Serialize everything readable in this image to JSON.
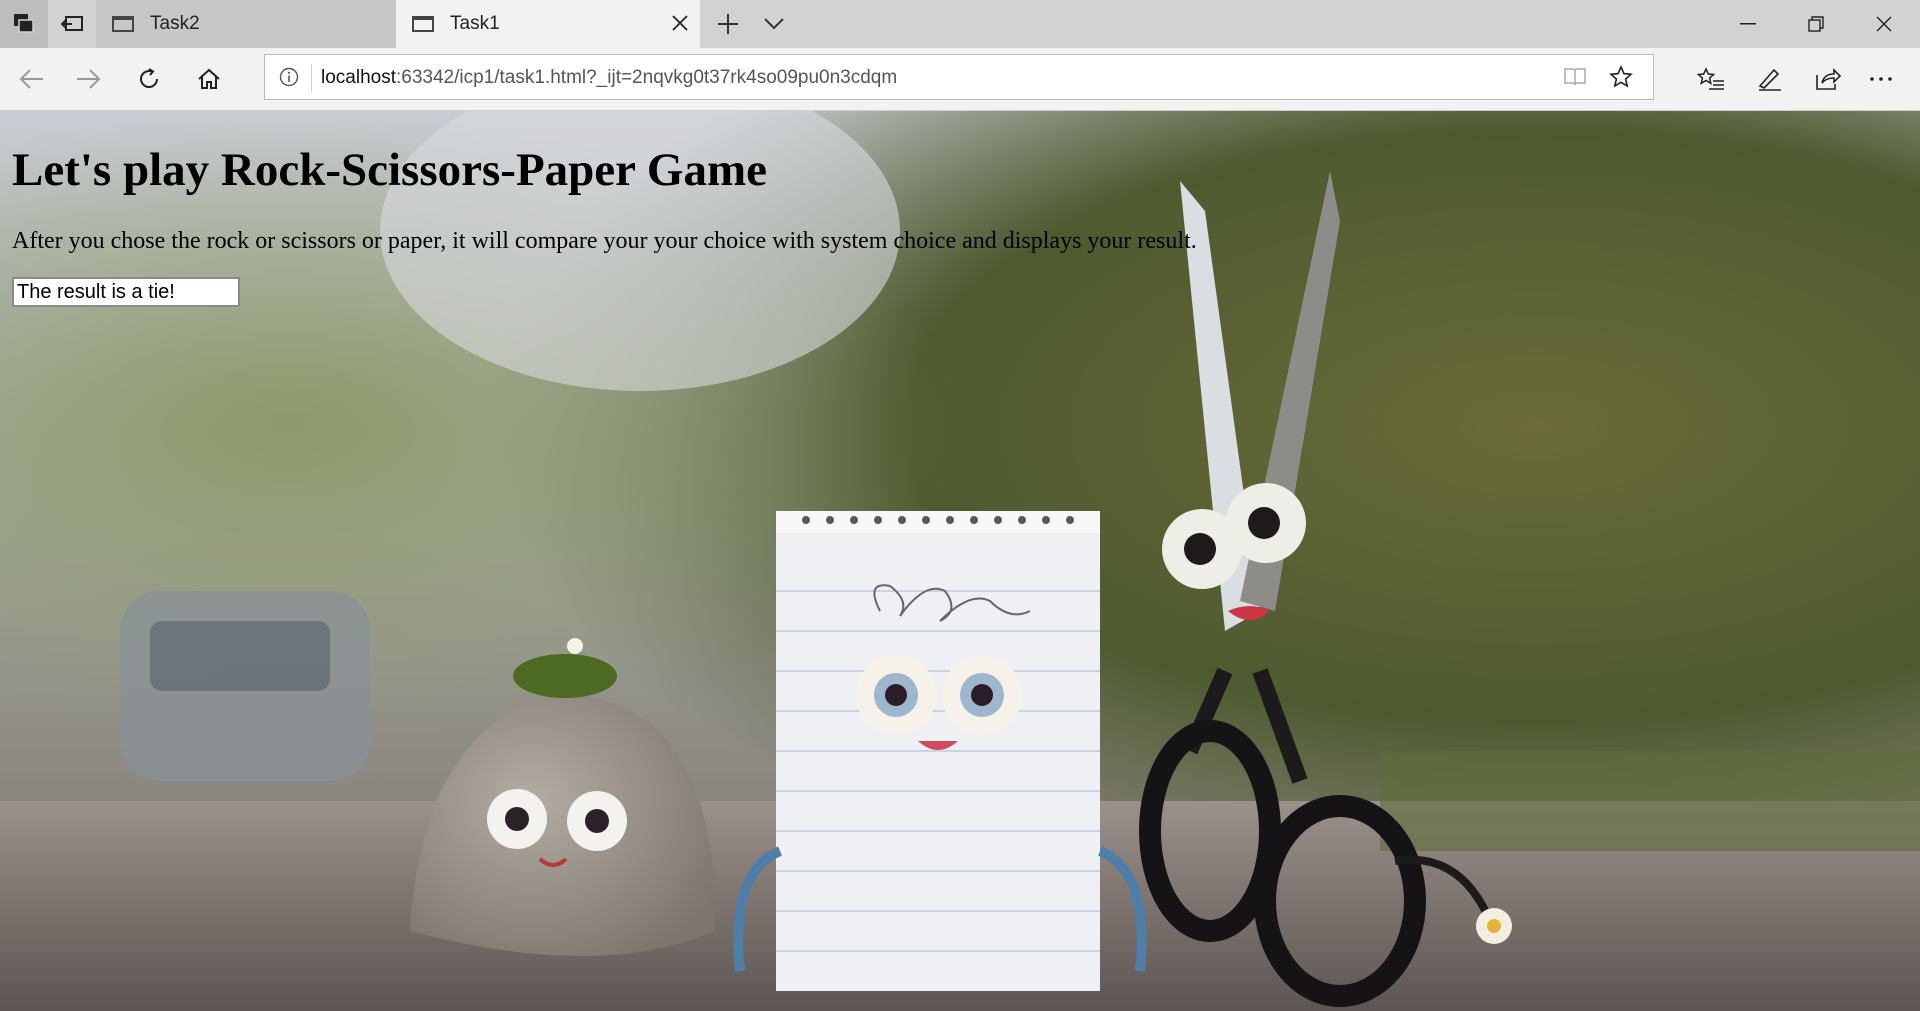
{
  "browser": {
    "tabs": [
      {
        "title": "Task2",
        "active": false
      },
      {
        "title": "Task1",
        "active": true
      }
    ],
    "address": {
      "host": "localhost",
      "path": ":63342/icp1/task1.html?_ijt=2nqvkg0t37rk4so09pu0n3cdqm"
    },
    "icons": {
      "tab_actions": "tab-actions-icon",
      "set_aside": "set-aside-tabs-icon",
      "back": "back-arrow-icon",
      "forward": "forward-arrow-icon",
      "refresh": "refresh-icon",
      "home": "home-icon",
      "info": "info-icon",
      "reading_view": "reading-view-icon",
      "favorite": "star-icon",
      "favorites_hub": "favorites-list-icon",
      "notes": "pen-icon",
      "share": "share-icon",
      "more": "more-ellipsis-icon"
    }
  },
  "page": {
    "heading": "Let's play Rock-Scissors-Paper Game",
    "description": "After you chose the rock or scissors or paper, it will compare your your choice with system choice and displays your result.",
    "result_value": "The result is a tie!"
  }
}
